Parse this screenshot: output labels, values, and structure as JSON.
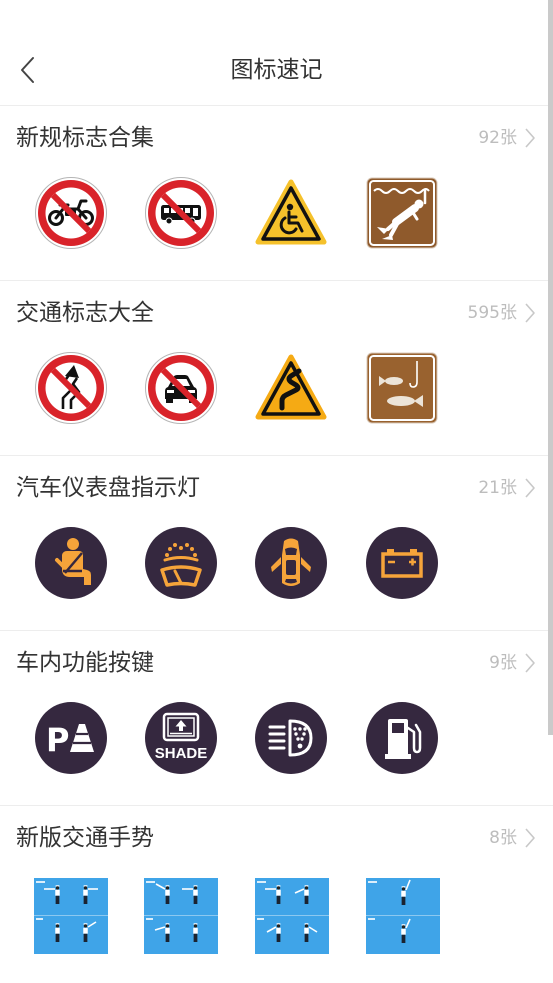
{
  "header": {
    "title": "图标速记",
    "back_icon": "chevron-left-icon"
  },
  "colors": {
    "text": "#333333",
    "count": "#bdbdbd",
    "divider": "#ededed",
    "prohibition_red": "#d9232a",
    "warning_yellow": "#f5c12b",
    "warning_orange": "#f5aa14",
    "guide_brown": "#8f5a2c",
    "dashboard_circle": "#35283f",
    "dashboard_orange": "#f6a43a",
    "gesture_blue": "#3fa4e8"
  },
  "sections": [
    {
      "title": "新规标志合集",
      "count": "92张",
      "more_icon": "chevron-right-icon",
      "icons": [
        "no-electric-bike-sign-icon",
        "no-bus-sign-icon",
        "wheelchair-warning-sign-icon",
        "scuba-diving-sign-icon"
      ]
    },
    {
      "title": "交通标志大全",
      "count": "595张",
      "more_icon": "chevron-right-icon",
      "icons": [
        "no-winding-arrow-sign-icon",
        "no-motor-vehicle-sign-icon",
        "winding-road-warning-sign-icon",
        "fishing-sign-icon"
      ]
    },
    {
      "title": "汽车仪表盘指示灯",
      "count": "21张",
      "more_icon": "chevron-right-icon",
      "icons": [
        "seatbelt-warning-icon",
        "washer-fluid-icon",
        "door-open-icon",
        "battery-warning-icon"
      ]
    },
    {
      "title": "车内功能按键",
      "count": "9张",
      "more_icon": "chevron-right-icon",
      "icons": [
        "parking-sensor-button-icon",
        "sunshade-button-icon",
        "headlight-leveling-button-icon",
        "fuel-door-button-icon"
      ],
      "icon_labels": {
        "parking": "P",
        "shade": "SHADE"
      }
    },
    {
      "title": "新版交通手势",
      "count": "8张",
      "more_icon": "chevron-right-icon",
      "icons": [
        "traffic-gesture-thumbnail-1",
        "traffic-gesture-thumbnail-2",
        "traffic-gesture-thumbnail-3",
        "traffic-gesture-thumbnail-4"
      ]
    }
  ]
}
